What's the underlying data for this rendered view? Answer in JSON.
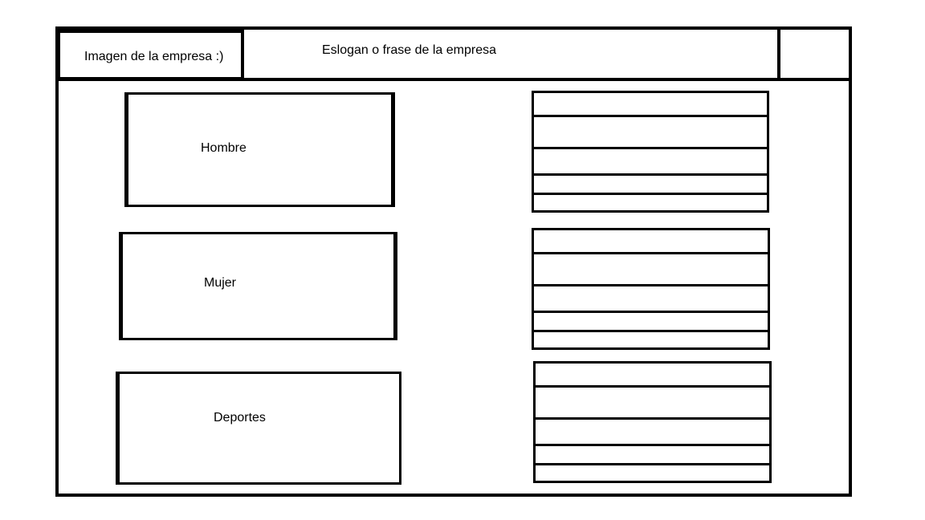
{
  "header": {
    "logo_text": "Imagen de la empresa :)",
    "slogan_text": "Eslogan o frase de la empresa"
  },
  "categories": [
    {
      "label": "Hombre"
    },
    {
      "label": "Mujer"
    },
    {
      "label": "Deportes"
    }
  ],
  "lists": [
    {
      "rows": 5
    },
    {
      "rows": 5
    },
    {
      "rows": 5
    }
  ]
}
